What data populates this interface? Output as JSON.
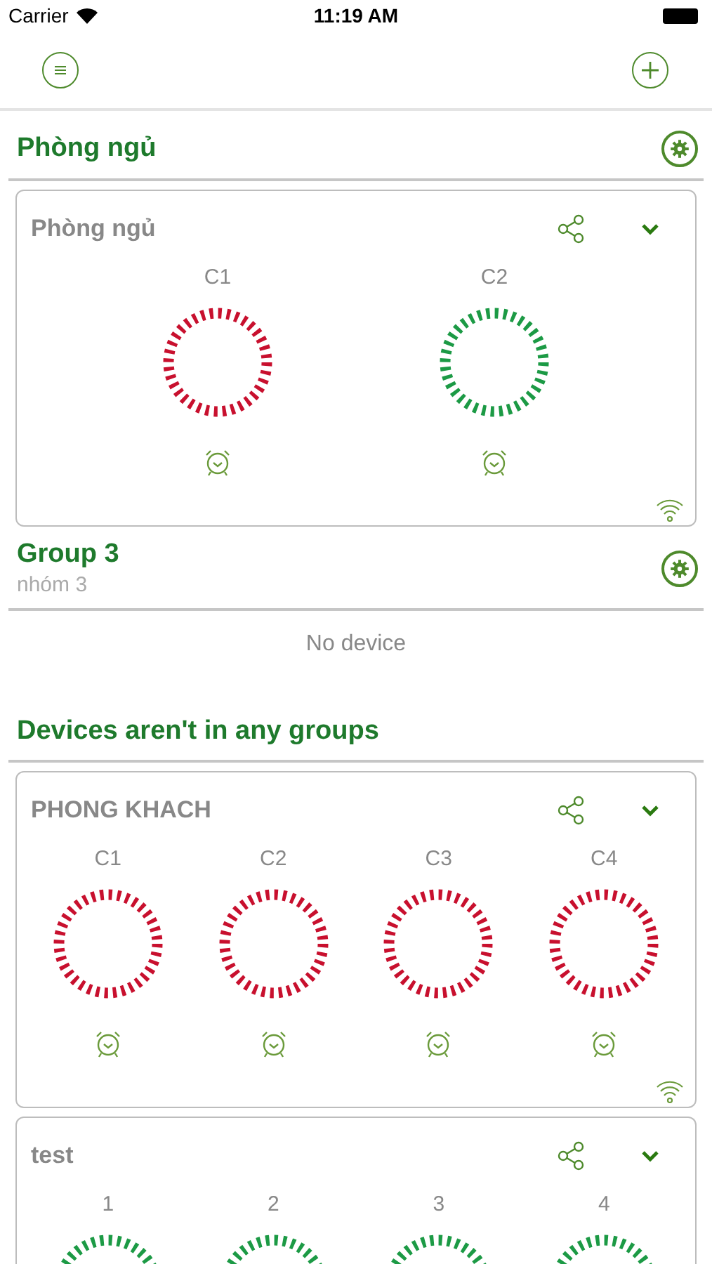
{
  "status_bar": {
    "carrier": "Carrier",
    "time": "11:19 AM"
  },
  "groups": [
    {
      "name": "Phòng ngủ",
      "devices": [
        {
          "name": "Phòng ngủ",
          "channels": [
            {
              "label": "C1",
              "on": false
            },
            {
              "label": "C2",
              "on": true
            }
          ]
        }
      ]
    },
    {
      "name": "Group 3",
      "subtitle": "nhóm 3",
      "empty_text": "No device"
    }
  ],
  "ungrouped": {
    "title": "Devices aren't in any groups",
    "devices": [
      {
        "name": "PHONG KHACH",
        "channels": [
          {
            "label": "C1",
            "on": false
          },
          {
            "label": "C2",
            "on": false
          },
          {
            "label": "C3",
            "on": false
          },
          {
            "label": "C4",
            "on": false
          }
        ]
      },
      {
        "name": "test",
        "clipped": true,
        "channels": [
          {
            "label": "1",
            "on": true
          },
          {
            "label": "2",
            "on": true
          },
          {
            "label": "3",
            "on": true
          },
          {
            "label": "4",
            "on": true
          }
        ]
      }
    ]
  }
}
